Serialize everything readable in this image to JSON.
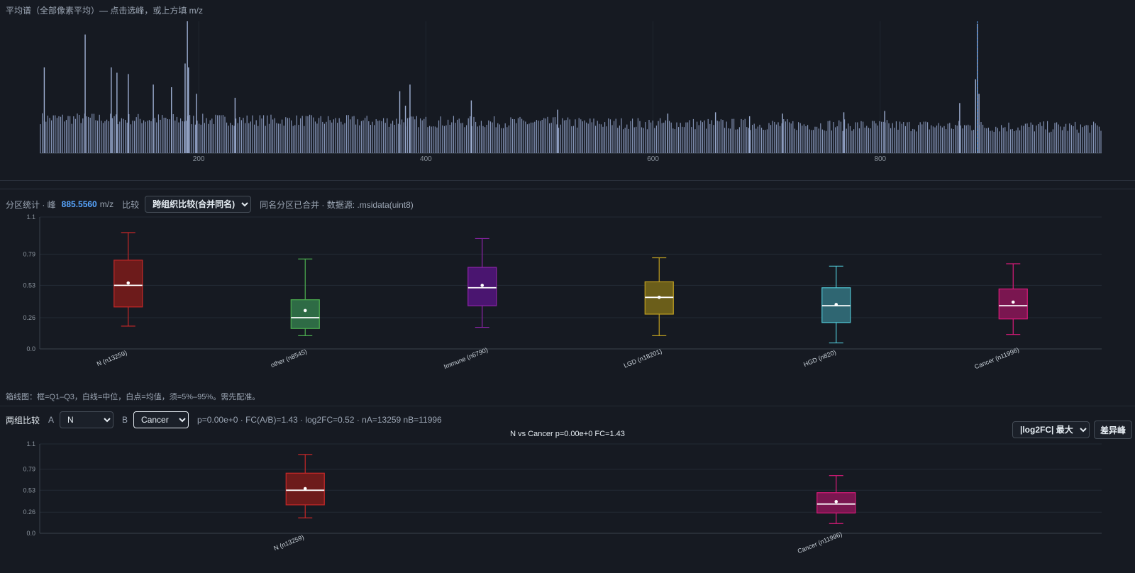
{
  "spectrum": {
    "title": "平均谱（全部像素平均）— 点击选峰，或上方填 m/z",
    "selected_mz": 885.556,
    "chart_data": {
      "type": "bar",
      "x_ticks": [
        200,
        400,
        600,
        800
      ],
      "xlim": [
        60,
        995
      ],
      "highlight_x": 885.556,
      "peaks": [
        {
          "x": 64,
          "y": 0.65
        },
        {
          "x": 100,
          "y": 0.9
        },
        {
          "x": 123,
          "y": 0.65
        },
        {
          "x": 128,
          "y": 0.61
        },
        {
          "x": 138,
          "y": 0.6
        },
        {
          "x": 160,
          "y": 0.52
        },
        {
          "x": 176,
          "y": 0.5
        },
        {
          "x": 188,
          "y": 0.68
        },
        {
          "x": 190,
          "y": 1.0
        },
        {
          "x": 191,
          "y": 0.65
        },
        {
          "x": 198,
          "y": 0.45
        },
        {
          "x": 232,
          "y": 0.42
        },
        {
          "x": 377,
          "y": 0.47
        },
        {
          "x": 382,
          "y": 0.36
        },
        {
          "x": 386,
          "y": 0.52
        },
        {
          "x": 440,
          "y": 0.4
        },
        {
          "x": 516,
          "y": 0.33
        },
        {
          "x": 613,
          "y": 0.3
        },
        {
          "x": 655,
          "y": 0.31
        },
        {
          "x": 685,
          "y": 0.28
        },
        {
          "x": 714,
          "y": 0.3
        },
        {
          "x": 768,
          "y": 0.31
        },
        {
          "x": 804,
          "y": 0.32
        },
        {
          "x": 870,
          "y": 0.38
        },
        {
          "x": 884,
          "y": 0.56
        },
        {
          "x": 885.556,
          "y": 0.98
        },
        {
          "x": 887,
          "y": 0.45
        }
      ]
    }
  },
  "stats": {
    "label_prefix": "分区统计 · 峰",
    "peak_value": "885.5560",
    "unit": "m/z",
    "compare_label": "比较",
    "compare_mode": "跨组织比较(合并同名)",
    "info": "同名分区已合并 · 数据源: .msidata(uint8)"
  },
  "chart_data": [
    {
      "type": "box",
      "ylim": [
        0,
        1.1
      ],
      "y_ticks": [
        "0.0",
        "0.26",
        "0.53",
        "0.79",
        "1.1"
      ],
      "groups": [
        {
          "label": "N (n13259)",
          "color": "#c62828",
          "fill": "#6d1b1b",
          "whisker_low": 0.19,
          "q1": 0.35,
          "median": 0.53,
          "mean": 0.55,
          "q3": 0.74,
          "whisker_high": 0.97
        },
        {
          "label": "other (n8545)",
          "color": "#4caf50",
          "fill": "#2e6b45",
          "whisker_low": 0.11,
          "q1": 0.17,
          "median": 0.26,
          "mean": 0.32,
          "q3": 0.41,
          "whisker_high": 0.75
        },
        {
          "label": "Immune (n6790)",
          "color": "#8e24aa",
          "fill": "#4a1570",
          "whisker_low": 0.18,
          "q1": 0.36,
          "median": 0.51,
          "mean": 0.53,
          "q3": 0.68,
          "whisker_high": 0.92
        },
        {
          "label": "LGD (n18201)",
          "color": "#c0a020",
          "fill": "#6b5e1a",
          "whisker_low": 0.11,
          "q1": 0.29,
          "median": 0.43,
          "mean": 0.43,
          "q3": 0.56,
          "whisker_high": 0.76
        },
        {
          "label": "HGD (n820)",
          "color": "#4fc3d1",
          "fill": "#2f6672",
          "whisker_low": 0.05,
          "q1": 0.22,
          "median": 0.36,
          "mean": 0.37,
          "q3": 0.51,
          "whisker_high": 0.69
        },
        {
          "label": "Cancer (n11996)",
          "color": "#d81b7a",
          "fill": "#7a1650",
          "whisker_low": 0.12,
          "q1": 0.25,
          "median": 0.36,
          "mean": 0.39,
          "q3": 0.5,
          "whisker_high": 0.71
        }
      ]
    },
    {
      "type": "box",
      "title": "N vs Cancer   p=0.00e+0   FC=1.43",
      "ylim": [
        0,
        1.1
      ],
      "y_ticks": [
        "0.0",
        "0.26",
        "0.53",
        "0.79",
        "1.1"
      ],
      "groups": [
        {
          "label": "N (n13259)",
          "color": "#c62828",
          "fill": "#6d1b1b",
          "whisker_low": 0.19,
          "q1": 0.35,
          "median": 0.53,
          "mean": 0.55,
          "q3": 0.74,
          "whisker_high": 0.97
        },
        {
          "label": "Cancer (n11996)",
          "color": "#d81b7a",
          "fill": "#7a1650",
          "whisker_low": 0.12,
          "q1": 0.25,
          "median": 0.36,
          "mean": 0.39,
          "q3": 0.5,
          "whisker_high": 0.71
        }
      ]
    }
  ],
  "note": "箱线图：框=Q1–Q3，白线=中位，白点=均值，须=5%–95%。需先配准。",
  "compare": {
    "label": "两组比较",
    "a_label": "A",
    "a_value": "N",
    "b_label": "B",
    "b_value": "Cancer",
    "result": "p=0.00e+0 · FC(A/B)=1.43 · log2FC=0.52 · nA=13259 nB=11996",
    "sort_value": "|log2FC| 最大",
    "diff_button": "差异峰"
  }
}
